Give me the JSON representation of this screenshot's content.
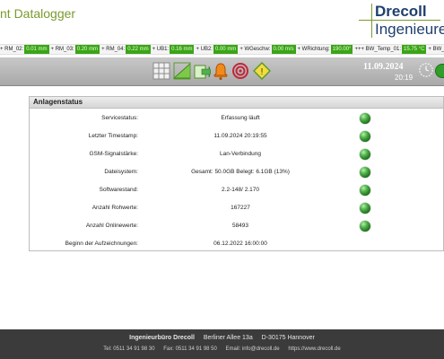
{
  "header": {
    "app_title": "nt Datalogger",
    "brand_line1": "Drecoll",
    "brand_line2": "Ingenieure",
    "brand_color": "#1f3f6e",
    "accent_color": "#7a9a2e"
  },
  "ticker": [
    {
      "label": "+ RM_02:",
      "value": "0.01 mm"
    },
    {
      "label": "+ RM_03:",
      "value": "0.20 mm"
    },
    {
      "label": "+ RM_04:",
      "value": "0.22 mm"
    },
    {
      "label": "+ UB1:",
      "value": "0.16 mm"
    },
    {
      "label": "+ UB2:",
      "value": "0.00 mm"
    },
    {
      "label": "+ WGeschw:",
      "value": "0.00 m/s"
    },
    {
      "label": "+ WRichtung:",
      "value": "190.00°"
    },
    {
      "label": "+++ BW_Temp_01:",
      "value": "15.75 °C"
    },
    {
      "label": "+ BW_Temp_02:",
      "value": "15.32 °C"
    },
    {
      "label": "+ HSD_T_0",
      "value": ""
    }
  ],
  "toolbar": {
    "icons": [
      "table-icon",
      "chart-icon",
      "export-icon",
      "alarm-bell-icon",
      "signal-icon",
      "warning-icon"
    ],
    "date": "11.09.2024",
    "time": "20:19"
  },
  "panel": {
    "title": "Anlagenstatus",
    "rows": [
      {
        "label": "Servicestatus:",
        "value": "Erfassung läuft",
        "status": "ok"
      },
      {
        "label": "Letzter Timestamp:",
        "value": "11.09.2024 20:19:55",
        "status": "ok"
      },
      {
        "label": "GSM-Signalstärke:",
        "value": "Lan-Verbindung",
        "status": "ok"
      },
      {
        "label": "Dateisystem:",
        "value": "Gesamt: 50.0GB Belegt: 6.1GB (13%)",
        "status": "ok"
      },
      {
        "label": "Softwarestand:",
        "value": "2.2-148/ 2.170",
        "status": "ok"
      },
      {
        "label": "Anzahl Rohwerte:",
        "value": "167227",
        "status": "ok"
      },
      {
        "label": "Anzahl Onlinewerte:",
        "value": "58493",
        "status": "ok"
      },
      {
        "label": "Beginn der Aufzeichnungen:",
        "value": "06.12.2022 16:00:00",
        "status": ""
      }
    ],
    "status_color": "#3aa516"
  },
  "footer": {
    "company": "Ingenieurbüro Drecoll",
    "street": "Berliner Allee 13a",
    "city": "D-30175 Hannover",
    "tel": "Tel: 0511 34 91 98 30",
    "fax": "Fax: 0511 34 91 98 50",
    "email": "Email: info@drecoll.de",
    "web": "https://www.drecoll.de"
  }
}
